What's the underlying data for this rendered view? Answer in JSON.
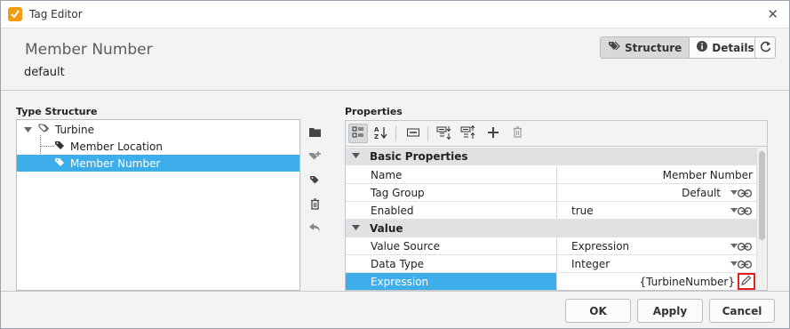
{
  "window": {
    "title": "Tag Editor",
    "close_glyph": "✕"
  },
  "header": {
    "tag_name": "Member Number",
    "provider": "default",
    "structure_label": "Structure",
    "details_label": "Details"
  },
  "type_structure": {
    "label": "Type Structure",
    "items": [
      {
        "label": "Turbine",
        "icon": "udt-icon"
      },
      {
        "label": "Member Location",
        "icon": "tag-icon"
      },
      {
        "label": "Member Number",
        "icon": "tag-icon",
        "selected": true
      }
    ]
  },
  "properties": {
    "label": "Properties",
    "categories": [
      {
        "name": "Basic Properties",
        "rows": [
          {
            "name": "Name",
            "value": "Member Number"
          },
          {
            "name": "Tag Group",
            "value": "Default"
          },
          {
            "name": "Enabled",
            "value": "true"
          }
        ]
      },
      {
        "name": "Value",
        "rows": [
          {
            "name": "Value Source",
            "value": "Expression"
          },
          {
            "name": "Data Type",
            "value": "Integer"
          },
          {
            "name": "Expression",
            "value": "{TurbineNumber}"
          }
        ]
      }
    ]
  },
  "footer": {
    "ok": "OK",
    "apply": "Apply",
    "cancel": "Cancel"
  },
  "colors": {
    "selection": "#3daee9",
    "highlight_border": "#e0201e",
    "app_icon": "#f39c12"
  }
}
